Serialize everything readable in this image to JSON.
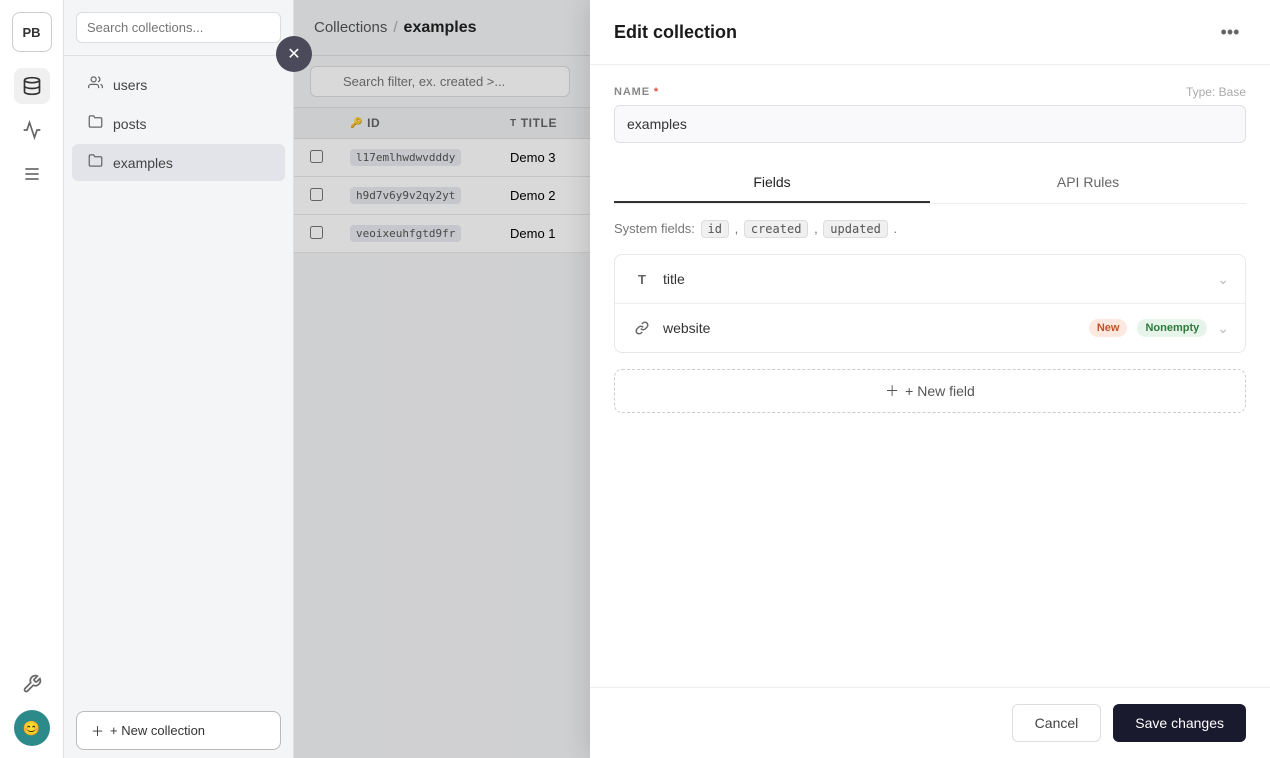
{
  "app": {
    "logo": "PB"
  },
  "sidebar": {
    "search_placeholder": "Search collections...",
    "items": [
      {
        "id": "users",
        "label": "users",
        "icon": "user-icon",
        "active": false
      },
      {
        "id": "posts",
        "label": "posts",
        "icon": "folder-icon",
        "active": false
      },
      {
        "id": "examples",
        "label": "examples",
        "icon": "folder-icon",
        "active": true
      }
    ],
    "new_collection_label": "+ New collection"
  },
  "breadcrumb": {
    "parent": "Collections",
    "separator": "/",
    "current": "examples"
  },
  "table": {
    "filter_placeholder": "Search filter, ex. created >...",
    "columns": [
      {
        "id": "checkbox",
        "label": ""
      },
      {
        "id": "id",
        "label": "id",
        "icon": "key-icon"
      },
      {
        "id": "title",
        "label": "title",
        "icon": "text-icon"
      }
    ],
    "rows": [
      {
        "id": "l17emlhwdwvdddy",
        "title": "Demo 3"
      },
      {
        "id": "h9d7v6y9v2qy2yt",
        "title": "Demo 2"
      },
      {
        "id": "veoixeuhfgtd9fr",
        "title": "Demo 1"
      }
    ]
  },
  "edit_panel": {
    "title": "Edit collection",
    "name_label": "NAME",
    "name_required": "*",
    "name_value": "examples",
    "type_hint": "Type: Base",
    "tabs": [
      {
        "id": "fields",
        "label": "Fields",
        "active": true
      },
      {
        "id": "api_rules",
        "label": "API Rules",
        "active": false
      }
    ],
    "system_fields_label": "System fields:",
    "system_fields": [
      "id",
      "created",
      "updated"
    ],
    "fields": [
      {
        "id": "title",
        "type_icon": "T",
        "name": "title",
        "badges": []
      },
      {
        "id": "website",
        "type_icon": "🔗",
        "name": "website",
        "badges": [
          {
            "label": "New",
            "type": "new"
          },
          {
            "label": "Nonempty",
            "type": "nonempty"
          }
        ]
      }
    ],
    "new_field_label": "+ New field",
    "cancel_label": "Cancel",
    "save_label": "Save changes"
  }
}
